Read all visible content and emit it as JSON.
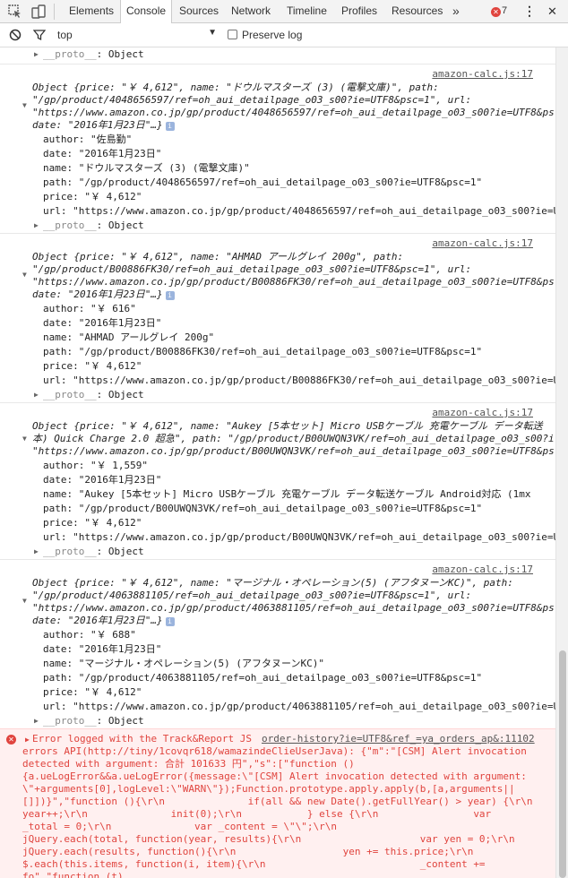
{
  "toolbar": {
    "tabs": [
      "Elements",
      "Console",
      "Sources",
      "Network",
      "Timeline",
      "Profiles",
      "Resources"
    ],
    "more": "»",
    "error_count": "7",
    "kebab": "⋮",
    "close": "✕"
  },
  "filter": {
    "context": "top",
    "preserve_log": "Preserve log"
  },
  "proto_label": "__proto__",
  "proto_value": ": Object",
  "messages": [
    {
      "source": "amazon-calc.js:17",
      "summary1": "Object {price: \"￥ 4,612\", name: \"ドウルマスターズ (3) (電撃文庫)\", path:",
      "summary2": "\"/gp/product/4048656597/ref=oh_aui_detailpage_o03_s00?ie=UTF8&psc=1\", url:",
      "summary3": "\"https://www.amazon.co.jp/gp/product/4048656597/ref=oh_aui_detailpage_o03_s00?ie=UTF8&ps",
      "summary4": "date: \"2016年1月23日\"…}",
      "author": "author: \"佐島勤\"",
      "date": "date: \"2016年1月23日\"",
      "name": "name: \"ドウルマスターズ (3) (電撃文庫)\"",
      "path": "path: \"/gp/product/4048656597/ref=oh_aui_detailpage_o03_s00?ie=UTF8&psc=1\"",
      "price": "price: \"￥ 4,612\"",
      "url": "url: \"https://www.amazon.co.jp/gp/product/4048656597/ref=oh_aui_detailpage_o03_s00?ie=U"
    },
    {
      "source": "amazon-calc.js:17",
      "summary1": "Object {price: \"￥ 4,612\", name: \"AHMAD アールグレイ 200g\", path:",
      "summary2": "\"/gp/product/B00886FK30/ref=oh_aui_detailpage_o03_s00?ie=UTF8&psc=1\", url:",
      "summary3": "\"https://www.amazon.co.jp/gp/product/B00886FK30/ref=oh_aui_detailpage_o03_s00?ie=UTF8&ps",
      "summary4": "date: \"2016年1月23日\"…}",
      "author": "author: \"￥ 616\"",
      "date": "date: \"2016年1月23日\"",
      "name": "name: \"AHMAD アールグレイ 200g\"",
      "path": "path: \"/gp/product/B00886FK30/ref=oh_aui_detailpage_o03_s00?ie=UTF8&psc=1\"",
      "price": "price: \"￥ 4,612\"",
      "url": "url: \"https://www.amazon.co.jp/gp/product/B00886FK30/ref=oh_aui_detailpage_o03_s00?ie=U"
    },
    {
      "source": "amazon-calc.js:17",
      "summary1": "Object {price: \"￥ 4,612\", name: \"Aukey [5本セット] Micro USBケーブル 充電ケーブル データ転送",
      "summary2": "本) Quick Charge 2.0 超急\", path: \"/gp/product/B00UWQN3VK/ref=oh_aui_detailpage_o03_s00?i",
      "summary3": "\"https://www.amazon.co.jp/gp/product/B00UWQN3VK/ref=oh_aui_detailpage_o03_s00?ie=UTF8&ps",
      "summary4": "",
      "author": "author: \"￥ 1,559\"",
      "date": "date: \"2016年1月23日\"",
      "name": "name: \"Aukey [5本セット] Micro USBケーブル 充電ケーブル データ転送ケーブル Android対応 (1mx",
      "path": "path: \"/gp/product/B00UWQN3VK/ref=oh_aui_detailpage_o03_s00?ie=UTF8&psc=1\"",
      "price": "price: \"￥ 4,612\"",
      "url": "url: \"https://www.amazon.co.jp/gp/product/B00UWQN3VK/ref=oh_aui_detailpage_o03_s00?ie=U"
    },
    {
      "source": "amazon-calc.js:17",
      "summary1": "Object {price: \"￥ 4,612\", name: \"マージナル・オペレーション(5) (アフタヌーンKC)\", path:",
      "summary2": "\"/gp/product/4063881105/ref=oh_aui_detailpage_o03_s00?ie=UTF8&psc=1\", url:",
      "summary3": "\"https://www.amazon.co.jp/gp/product/4063881105/ref=oh_aui_detailpage_o03_s00?ie=UTF8&ps",
      "summary4": "date: \"2016年1月23日\"…}",
      "author": "author: \"￥ 688\"",
      "date": "date: \"2016年1月23日\"",
      "name": "name: \"マージナル・オペレーション(5) (アフタヌーンKC)\"",
      "path": "path: \"/gp/product/4063881105/ref=oh_aui_detailpage_o03_s00?ie=UTF8&psc=1\"",
      "price": "price: \"￥ 4,612\"",
      "url": "url: \"https://www.amazon.co.jp/gp/product/4063881105/ref=oh_aui_detailpage_o03_s00?ie=U"
    }
  ],
  "error": {
    "source": "order-history?ie=UTF8&ref_=ya_orders_ap&:11102",
    "lines": [
      "Error logged with the Track&Report JS",
      "errors API(http://tiny/1covqr618/wamazindeClieUserJava): {\"m\":\"[CSM] Alert invocation",
      "detected with argument: 合計 101633 円\",\"s\":[\"function ()",
      "{a.ueLogError&&a.ueLogError({message:\\\"[CSM] Alert invocation detected with argument:",
      "\\\"+arguments[0],logLevel:\\\"WARN\\\"});Function.prototype.apply.apply(b,[a,arguments||",
      "[]])}\",\"function (){\\r\\n              if(all && new Date().getFullYear() > year) {\\r\\n",
      "year++;\\r\\n              init(0);\\r\\n           } else {\\r\\n                var",
      "_total = 0;\\r\\n              var _content = \\\"\\\";\\r\\n",
      "jQuery.each(total, function(year, results){\\r\\n                    var yen = 0;\\r\\n",
      "jQuery.each(results, function(){\\r\\n                  yen += this.price;\\r\\n",
      "$.each(this.items, function(i, item){\\r\\n                          _content +=",
      "fo\",\"function (t)"
    ]
  }
}
